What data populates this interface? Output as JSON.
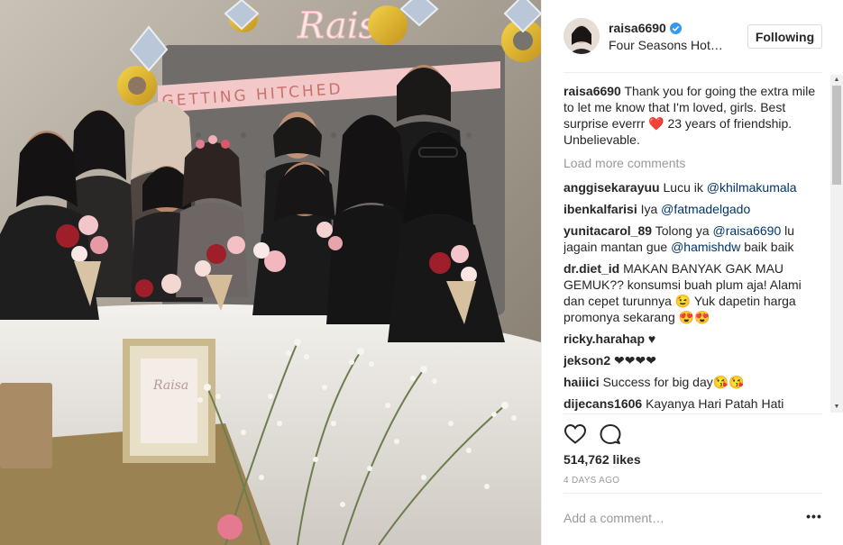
{
  "post": {
    "username": "raisa6690",
    "location": "Four Seasons Hot…",
    "follow_label": "Following",
    "caption_user": "raisa6690",
    "caption_text": "Thank you for going the extra mile to let me know that I'm loved, girls. Best surprise everrr ❤️ 23 years of friendship. Unbelievable.",
    "photo_banner": "GETTING HITCHED",
    "photo_sign": "Raisa",
    "frame_text": "Raisa"
  },
  "comments": {
    "load_more": "Load more comments",
    "items": [
      {
        "user": "anggisekarayuu",
        "parts": [
          {
            "t": "Lucu ik "
          },
          {
            "m": "@khilmakumala"
          }
        ]
      },
      {
        "user": "ibenkalfarisi",
        "parts": [
          {
            "t": "Iya "
          },
          {
            "m": "@fatmadelgado"
          }
        ]
      },
      {
        "user": "yunitacarol_89",
        "parts": [
          {
            "t": "Tolong ya "
          },
          {
            "m": "@raisa6690"
          },
          {
            "t": " lu jagain mantan gue "
          },
          {
            "m": "@hamishdw"
          },
          {
            "t": " baik baik"
          }
        ]
      },
      {
        "user": "dr.diet_id",
        "parts": [
          {
            "t": "MAKAN BANYAK GAK MAU GEMUK?? konsumsi buah plum aja! Alami dan cepet turunnya 😉 Yuk dapetin harga promonya sekarang 😍😍"
          }
        ]
      },
      {
        "user": "ricky.harahap",
        "parts": [
          {
            "t": "♥"
          }
        ]
      },
      {
        "user": "jekson2",
        "parts": [
          {
            "t": "❤❤❤❤"
          }
        ]
      },
      {
        "user": "haiiici",
        "parts": [
          {
            "t": "Success for big day😘😘"
          }
        ]
      },
      {
        "user": "dijecans1606",
        "parts": [
          {
            "t": "Kayanya Hari Patah Hati"
          }
        ]
      }
    ]
  },
  "actions": {
    "like_icon": "heart-outline-icon",
    "comment_icon": "speech-bubble-icon",
    "likes": "514,762 likes",
    "time": "4 DAYS AGO",
    "add_comment_placeholder": "Add a comment…",
    "more_icon": "more-options-icon",
    "more_label": "•••"
  },
  "colors": {
    "text": "#262626",
    "muted": "#999999",
    "mention": "#003569",
    "verified": "#3897f0",
    "border": "#efefef"
  }
}
